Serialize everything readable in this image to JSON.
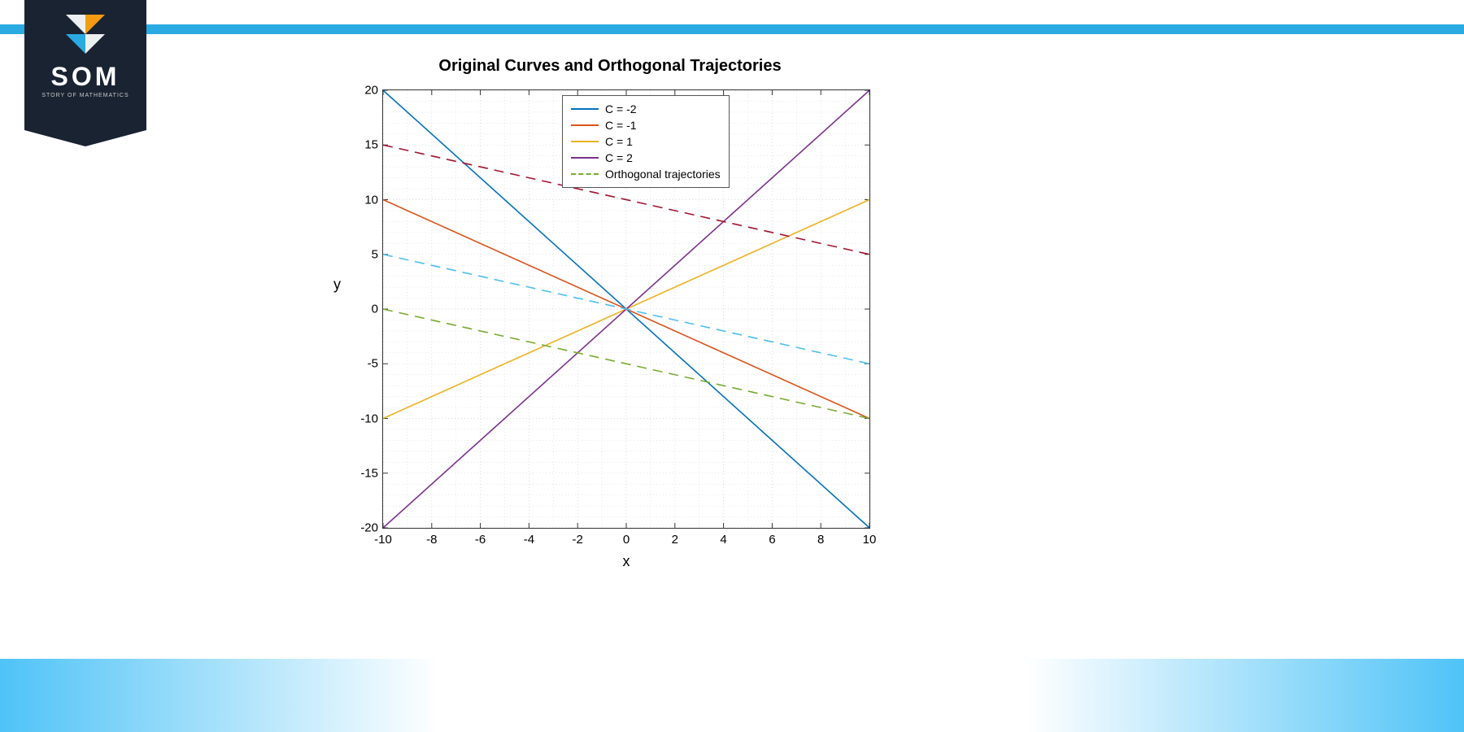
{
  "brand": {
    "title": "SOM",
    "subtitle": "STORY OF MATHEMATICS"
  },
  "chart_data": {
    "type": "line",
    "title": "Original Curves and Orthogonal Trajectories",
    "xlabel": "x",
    "ylabel": "y",
    "xlim": [
      -10,
      10
    ],
    "ylim": [
      -20,
      20
    ],
    "x_ticks": [
      -10,
      -8,
      -6,
      -4,
      -2,
      0,
      2,
      4,
      6,
      8,
      10
    ],
    "y_ticks": [
      -20,
      -15,
      -10,
      -5,
      0,
      5,
      10,
      15,
      20
    ],
    "series": [
      {
        "name": "C = -2",
        "slope": -2,
        "intercept": 0,
        "color": "#0072BD",
        "style": "solid"
      },
      {
        "name": "C = -1",
        "slope": -1,
        "intercept": 0,
        "color": "#D95319",
        "style": "solid"
      },
      {
        "name": "C = 1",
        "slope": 1,
        "intercept": 0,
        "color": "#EDB120",
        "style": "solid"
      },
      {
        "name": "C = 2",
        "slope": 2,
        "intercept": 0,
        "color": "#7E2F8E",
        "style": "solid"
      },
      {
        "name": "Orthogonal trajectories",
        "ortho": true,
        "color": "#77AC30",
        "style": "dashed"
      }
    ],
    "orthogonal_lines": [
      {
        "slope": -0.5,
        "intercept": 10,
        "color": "#A2142F",
        "style": "dashed"
      },
      {
        "slope": -0.5,
        "intercept": 0,
        "color": "#4DBEEE",
        "style": "dashed"
      },
      {
        "slope": -0.5,
        "intercept": -5,
        "color": "#77AC30",
        "style": "dashed"
      }
    ],
    "legend_items": [
      {
        "label": "C = -2",
        "color": "#0072BD",
        "dash": false
      },
      {
        "label": "C = -1",
        "color": "#D95319",
        "dash": false
      },
      {
        "label": "C = 1",
        "color": "#EDB120",
        "dash": false
      },
      {
        "label": "C = 2",
        "color": "#7E2F8E",
        "dash": false
      },
      {
        "label": "Orthogonal trajectories",
        "color": "#77AC30",
        "dash": true
      }
    ]
  }
}
